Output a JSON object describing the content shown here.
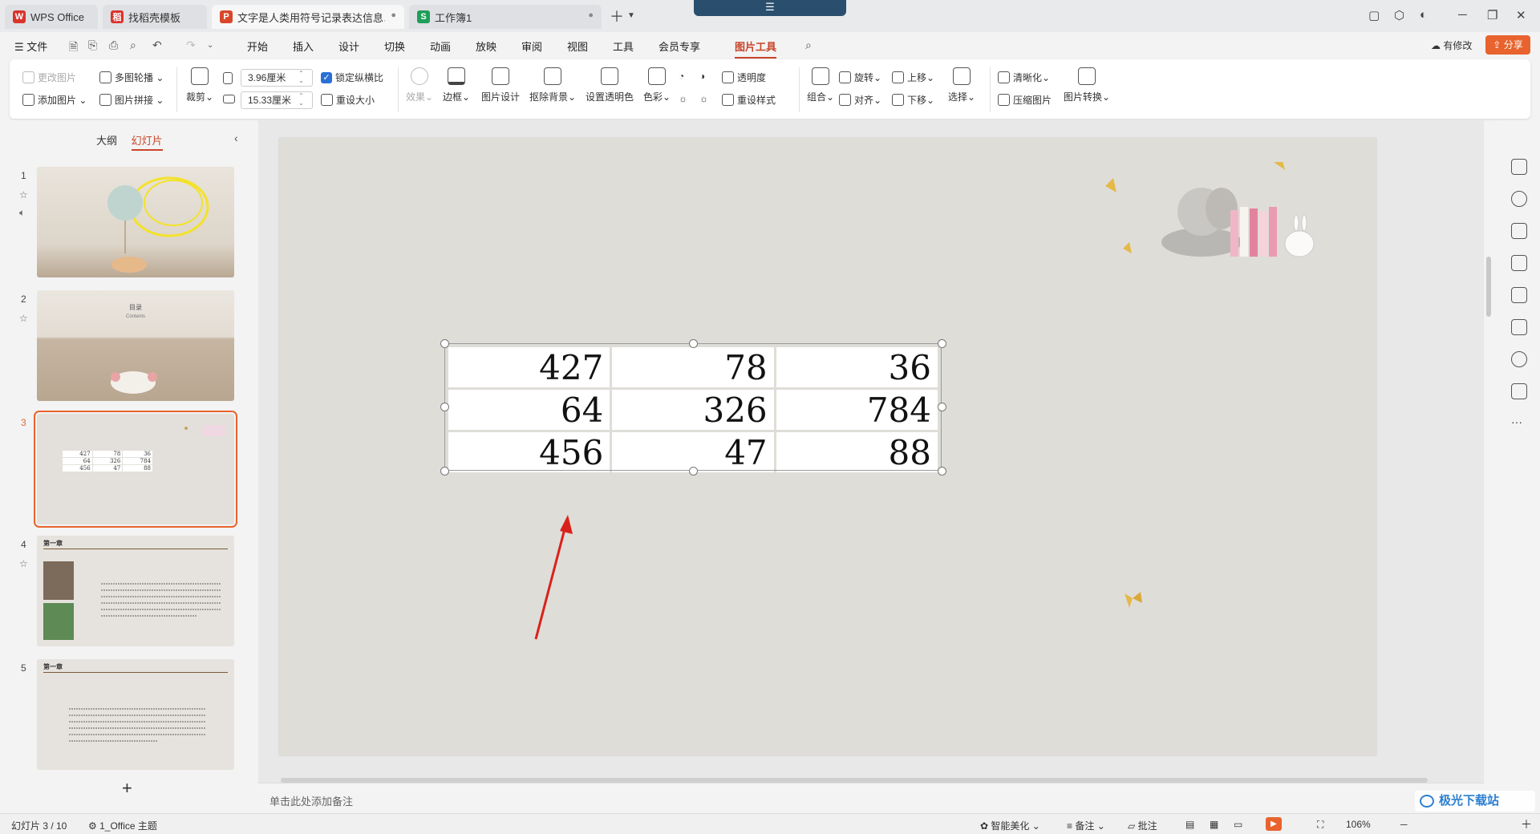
{
  "tabs": [
    {
      "label": "WPS Office",
      "color": "#d9342b",
      "glyph": "W"
    },
    {
      "label": "找稻壳模板",
      "color": "#d9342b",
      "glyph": "稻"
    },
    {
      "label": "文字是人类用符号记录表达信息以",
      "color": "#d9472b",
      "glyph": "P"
    },
    {
      "label": "工作簿1",
      "color": "#1e9e5a",
      "glyph": "S"
    }
  ],
  "menu": {
    "file": "文件",
    "items": [
      "开始",
      "插入",
      "设计",
      "切换",
      "动画",
      "放映",
      "审阅",
      "视图",
      "工具",
      "会员专享",
      "图片工具"
    ],
    "active": "图片工具",
    "modified": "有修改",
    "share": "分享"
  },
  "ribbon": {
    "change_image": "更改图片",
    "add_image": "添加图片",
    "multi_carousel": "多图轮播",
    "image_collage": "图片拼接",
    "crop": "裁剪",
    "width": "3.96厘米",
    "height": "15.33厘米",
    "lock_ratio": "锁定纵横比",
    "reset_size": "重设大小",
    "effects": "效果",
    "border": "边框",
    "image_design": "图片设计",
    "remove_bg": "抠除背景",
    "set_transparent": "设置透明色",
    "color": "色彩",
    "transparency": "透明度",
    "reset_style": "重设样式",
    "group": "组合",
    "rotate": "旋转",
    "align": "对齐",
    "bring_up": "上移",
    "send_down": "下移",
    "select": "选择",
    "sharpen": "清晰化",
    "compress": "压缩图片",
    "convert": "图片转换"
  },
  "leftpanel": {
    "tab_outline": "大纲",
    "tab_slides": "幻灯片",
    "slides": [
      "1",
      "2",
      "3",
      "4",
      "5"
    ],
    "thumb2_title": "目录",
    "thumb2_sub": "Contents",
    "thumb4_title": "第一章",
    "thumb5_title": "第一章",
    "add": "+"
  },
  "table": [
    [
      "427",
      "78",
      "36"
    ],
    [
      "64",
      "326",
      "784"
    ],
    [
      "456",
      "47",
      "88"
    ]
  ],
  "notes": "单击此处添加备注",
  "status": {
    "slide_counter": "幻灯片 3 / 10",
    "theme": "1_Office 主题",
    "beautify": "智能美化",
    "notes": "备注",
    "comment": "批注",
    "zoom": "106%"
  },
  "watermark": "极光下载站"
}
